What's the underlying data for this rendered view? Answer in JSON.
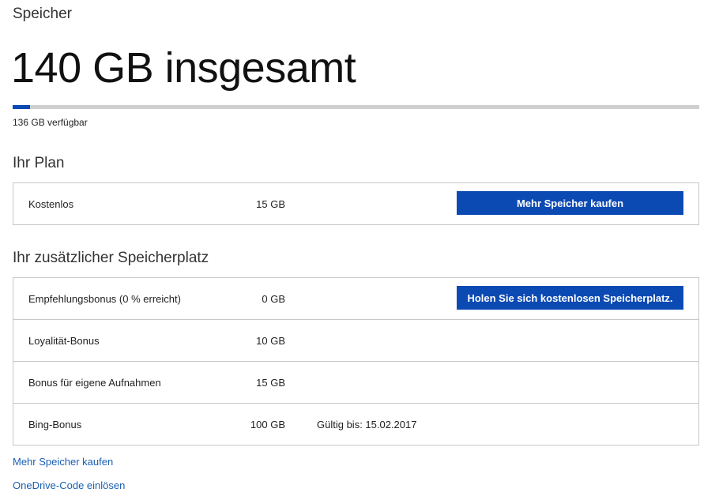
{
  "page": {
    "section_label": "Speicher",
    "total_title": "140 GB insgesamt",
    "usage_fraction": 0.025,
    "available_text": "136 GB verfügbar",
    "accent_color": "#0c4ab3"
  },
  "plan": {
    "heading": "Ihr Plan",
    "rows": [
      {
        "label": "Kostenlos",
        "size": "15 GB",
        "button_label": "Mehr Speicher kaufen"
      }
    ]
  },
  "extra": {
    "heading": "Ihr zusätzlicher Speicherplatz",
    "rows": [
      {
        "label": "Empfehlungsbonus (0 % erreicht)",
        "size": "0 GB",
        "button_label": "Holen Sie sich kostenlosen Speicherplatz."
      },
      {
        "label": "Loyalität-Bonus",
        "size": "10 GB"
      },
      {
        "label": "Bonus für eigene Aufnahmen",
        "size": "15 GB"
      },
      {
        "label": "Bing-Bonus",
        "size": "100 GB",
        "note": "Gültig bis: 15.02.2017"
      }
    ]
  },
  "links": {
    "buy_more": "Mehr Speicher kaufen",
    "redeem_code": "OneDrive-Code einlösen"
  }
}
